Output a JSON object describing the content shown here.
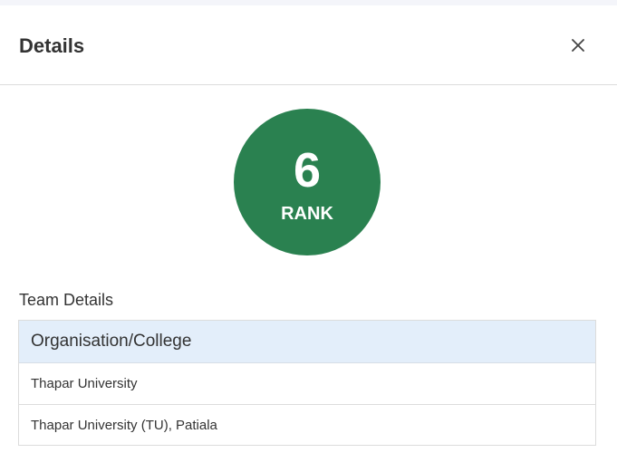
{
  "modal": {
    "title": "Details",
    "close_icon": "close-icon"
  },
  "rank": {
    "value": "6",
    "label": "RANK",
    "color": "#2a8150"
  },
  "team_details": {
    "section_title": "Team Details",
    "table": {
      "header": "Organisation/College",
      "rows": [
        "Thapar University",
        "Thapar University (TU), Patiala"
      ]
    }
  }
}
